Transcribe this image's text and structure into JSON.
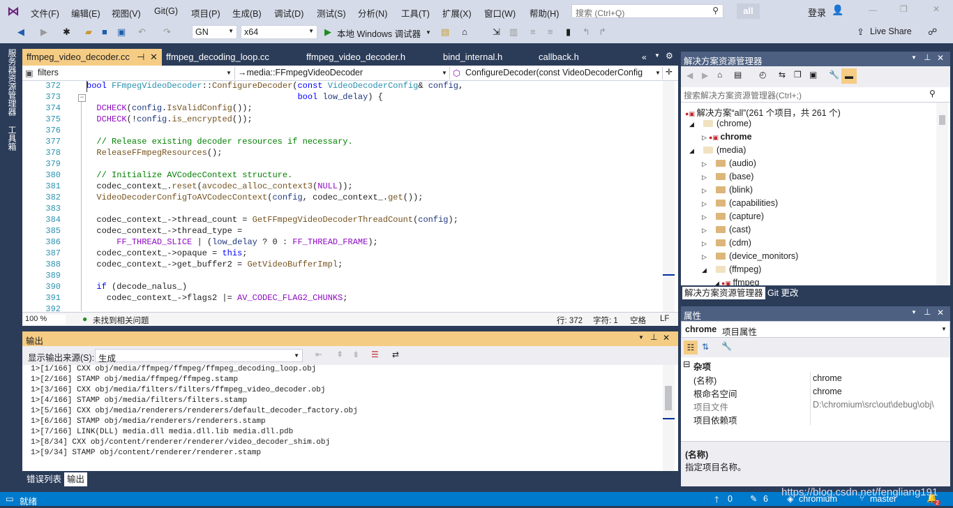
{
  "menu": {
    "items": [
      "文件(F)",
      "编辑(E)",
      "视图(V)",
      "Git(G)",
      "项目(P)",
      "生成(B)",
      "调试(D)",
      "测试(S)",
      "分析(N)",
      "工具(T)",
      "扩展(X)",
      "窗口(W)",
      "帮助(H)"
    ],
    "search_placeholder": "搜索 (Ctrl+Q)",
    "solution_badge": "all",
    "signin": "登录"
  },
  "toolbar": {
    "config": "GN",
    "platform": "x64",
    "run_label": "本地 Windows 调试器",
    "live_share": "Live Share"
  },
  "left_strip": {
    "tab1": "服务器资源管理器",
    "tab2": "工具箱"
  },
  "doc_tabs": [
    "ffmpeg_video_decoder.cc",
    "ffmpeg_decoding_loop.cc",
    "ffmpeg_video_decoder.h",
    "bind_internal.h",
    "callback.h"
  ],
  "nav": {
    "project": "filters",
    "scope": "→media::FFmpegVideoDecoder",
    "member": "ConfigureDecoder(const VideoDecoderConfig"
  },
  "code": {
    "line_numbers": [
      "372",
      "373",
      "374",
      "375",
      "376",
      "377",
      "378",
      "379",
      "380",
      "381",
      "382",
      "383",
      "384",
      "385",
      "386",
      "387",
      "388",
      "389",
      "390",
      "391",
      "392"
    ]
  },
  "editor_status": {
    "zoom": "100 %",
    "issues": "未找到相关问题",
    "line": "行: 372",
    "col": "字符: 1",
    "ws": "空格",
    "eol": "LF"
  },
  "output": {
    "title": "输出",
    "source_label": "显示输出来源(S):",
    "source_value": "生成",
    "lines": [
      "1>[1/166] CXX obj/media/ffmpeg/ffmpeg/ffmpeg_decoding_loop.obj",
      "1>[2/166] STAMP obj/media/ffmpeg/ffmpeg.stamp",
      "1>[3/166] CXX obj/media/filters/filters/ffmpeg_video_decoder.obj",
      "1>[4/166] STAMP obj/media/filters/filters.stamp",
      "1>[5/166] CXX obj/media/renderers/renderers/default_decoder_factory.obj",
      "1>[6/166] STAMP obj/media/renderers/renderers.stamp",
      "1>[7/166] LINK(DLL) media.dll media.dll.lib media.dll.pdb",
      "1>[8/34] CXX obj/content/renderer/renderer/video_decoder_shim.obj",
      "1>[9/34] STAMP obj/content/renderer/renderer.stamp"
    ]
  },
  "bottom_tabs": [
    "错误列表",
    "输出"
  ],
  "solution_explorer": {
    "title": "解决方案资源管理器",
    "search_placeholder": "搜索解决方案资源管理器(Ctrl+;)",
    "root": "解决方案“all”(261 个项目，共 261 个)",
    "nodes": [
      "(chrome)",
      "chrome",
      "(media)",
      "(audio)",
      "(base)",
      "(blink)",
      "(capabilities)",
      "(capture)",
      "(cast)",
      "(cdm)",
      "(device_monitors)",
      "(ffmpeg)",
      "ffmpeg"
    ],
    "tabs": [
      "解决方案资源管理器",
      "Git 更改"
    ]
  },
  "properties": {
    "title": "属性",
    "selected_name": "chrome",
    "selected_type": "项目属性",
    "category": "杂项",
    "rows": [
      {
        "name": "(名称)",
        "value": "chrome"
      },
      {
        "name": "根命名空间",
        "value": "chrome"
      },
      {
        "name": "项目文件",
        "value": "D:\\chromium\\src\\out\\debug\\obj\\"
      },
      {
        "name": "项目依赖项",
        "value": ""
      }
    ],
    "desc_title": "(名称)",
    "desc_text": "指定项目名称。"
  },
  "statusbar": {
    "ready": "就绪",
    "up": "0",
    "pencil": "6",
    "repo": "chromium",
    "branch": "master",
    "notif": "2"
  },
  "watermark": "https://blog.csdn.net/fengliang191"
}
